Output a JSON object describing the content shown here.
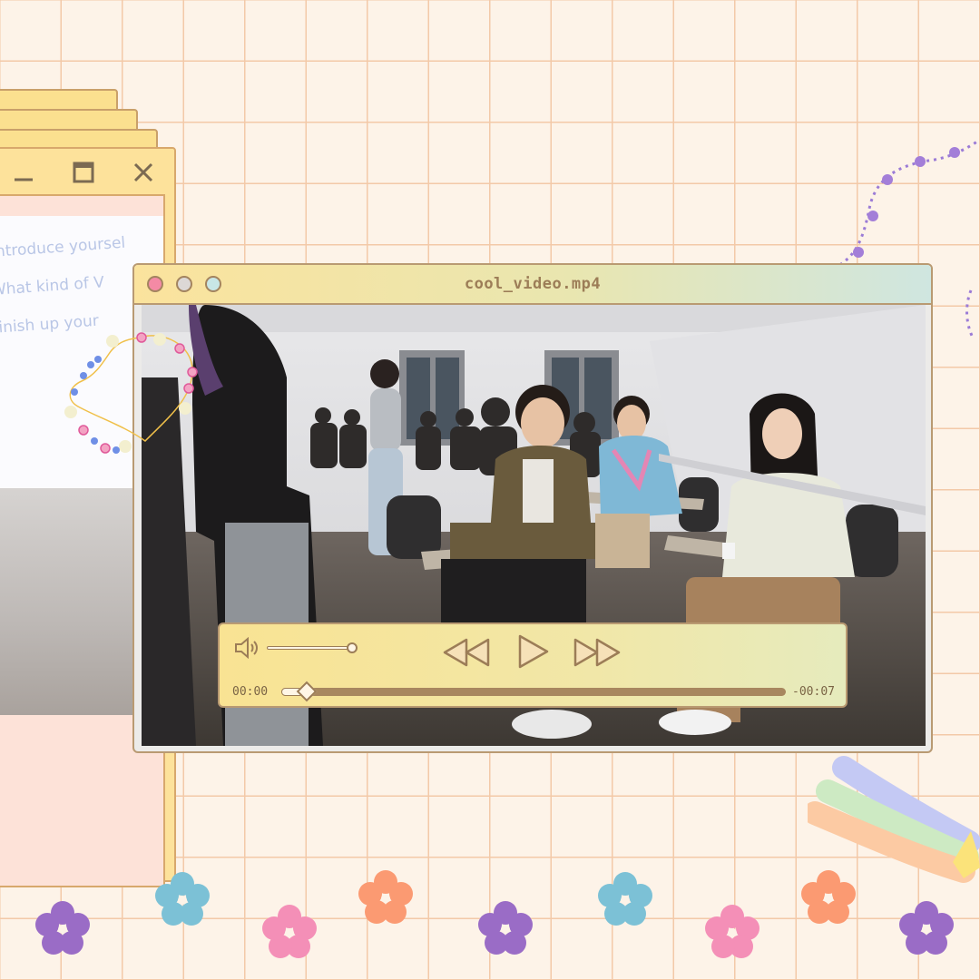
{
  "player": {
    "title": "cool_video.mp4",
    "time_elapsed": "00:00",
    "time_remaining": "-00:07",
    "progress": 0.03,
    "volume": 0.95,
    "window_buttons": [
      "close-dot",
      "minimize-dot",
      "maximize-dot"
    ]
  },
  "slide": {
    "lines": [
      "Introduce yoursel",
      "What kind of V",
      "Finish up your"
    ]
  },
  "colors": {
    "background": "#fdf3e8",
    "grid": "#f3c9a8",
    "accent_brown": "#b99a72",
    "dot_pink": "#f48aa5",
    "dot_grey": "#dcd8d6",
    "dot_teal": "#c8e6e6"
  },
  "icons": [
    "volume-icon",
    "rewind-icon",
    "play-icon",
    "fast-forward-icon",
    "minimize-icon",
    "maximize-icon",
    "close-icon"
  ]
}
